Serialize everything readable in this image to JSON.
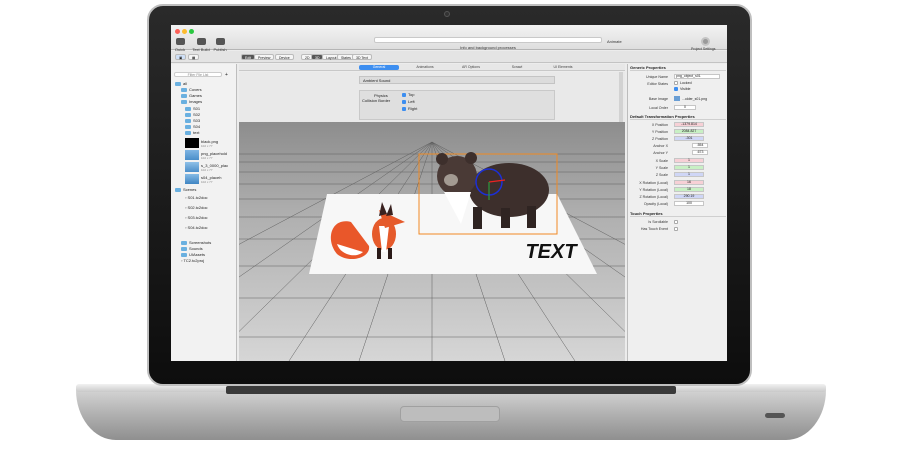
{
  "toolbar": {
    "quick_text": "Quick Text",
    "text_build": "Text Build",
    "publish": "Publish",
    "status": "Info and background processes",
    "animate": "Animate",
    "project_settings": "Project Settings"
  },
  "toolbar2": {
    "edit": "Edit",
    "preview": "Preview",
    "device": "Device",
    "d2": "2D",
    "d3": "3D",
    "layout": "Layout",
    "states": "States",
    "text_3d": "3D Text"
  },
  "sidebar": {
    "filter_placeholder": "Filter File List",
    "items": [
      {
        "label": "all"
      },
      {
        "label": "Covers"
      },
      {
        "label": "Games"
      },
      {
        "label": "Images"
      },
      {
        "label": "S01"
      },
      {
        "label": "S02"
      },
      {
        "label": "S03"
      },
      {
        "label": "S04"
      },
      {
        "label": "text"
      }
    ],
    "assets": [
      {
        "label": "black.png",
        "sub": "102 x 77"
      },
      {
        "label": "png_placehold",
        "sub": "102 x 77"
      },
      {
        "label": "s_3_0000_plac",
        "sub": "102 x 77"
      },
      {
        "label": "s04_placeh",
        "sub": "102 x 77"
      }
    ],
    "scenes_label": "Scenes",
    "scenes": [
      {
        "label": "S01.tc2doc"
      },
      {
        "label": "S02.tc2doc"
      },
      {
        "label": "S03.tc2doc"
      },
      {
        "label": "S04.tc2doc"
      }
    ],
    "bottom": [
      {
        "label": "Screenshots"
      },
      {
        "label": "Sounds"
      },
      {
        "label": "UIAssets"
      },
      {
        "label": "TC2.tc2proj"
      }
    ]
  },
  "tabs": [
    {
      "label": "General"
    },
    {
      "label": "Animations"
    },
    {
      "label": "AR Options"
    },
    {
      "label": "Scrawl"
    },
    {
      "label": "UI Elements"
    }
  ],
  "settings": {
    "ambient_sound": "Ambient Sound",
    "physics": "Physics",
    "collision_border": "Collision Border",
    "top": "Top",
    "left": "Left",
    "right": "Right"
  },
  "viewport": {
    "canvas_text": "TEXT"
  },
  "inspector": {
    "generic_title": "Generic Properties",
    "unique_name_label": "Unique Name",
    "unique_name": "png_object_s01",
    "editor_states_label": "Editor States",
    "locked": "Locked",
    "visible": "Visible",
    "base_image_label": "Base Image",
    "base_image": "...older_s01.png",
    "local_order_label": "Local Order",
    "local_order": "0",
    "transform_title": "Default Transformation Properties",
    "x_pos_label": "X Position",
    "x_pos": "-1379.814",
    "y_pos_label": "Y Position",
    "y_pos": "2084.827",
    "z_pos_label": "Z Position",
    "z_pos": "-301",
    "anchor_x_label": "Anchor X",
    "anchor_x": ".554",
    "anchor_y_label": "Anchor Y",
    "anchor_y": ".673",
    "x_scale_label": "X Scale",
    "x_scale": "1",
    "y_scale_label": "Y Scale",
    "y_scale": "1",
    "z_scale_label": "Z Scale",
    "z_scale": "1",
    "x_rot_label": "X Rotation (Local)",
    "x_rot": "16",
    "y_rot_label": "Y Rotation (Local)",
    "y_rot": "18",
    "z_rot_label": "Z Rotation (Local)",
    "z_rot": "290.19",
    "opacity_label": "Opacity (Local)",
    "opacity": "100",
    "touch_title": "Touch Properties",
    "is_scrollable": "Is Scrollable",
    "has_touch_event": "Has Touch Event"
  }
}
